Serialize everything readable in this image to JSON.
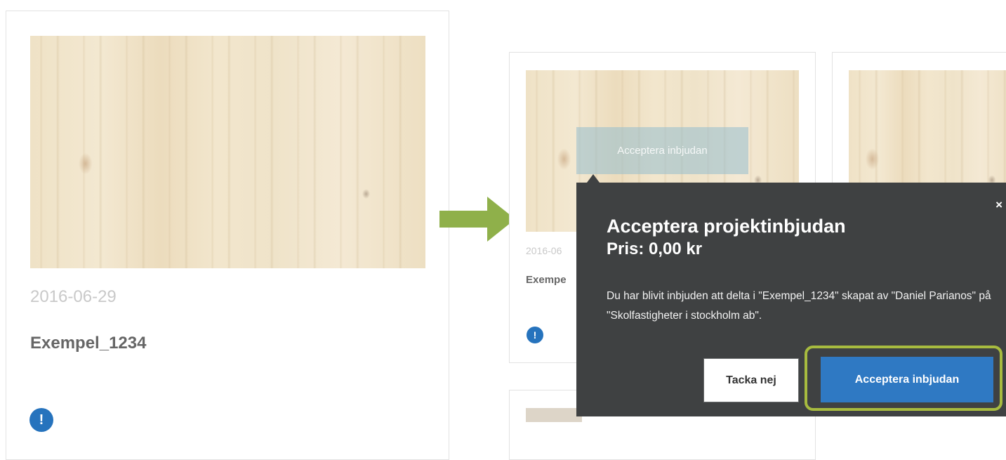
{
  "left_card": {
    "date": "2016-06-29",
    "title": "Exempel_1234",
    "info_icon": "!"
  },
  "right_card": {
    "date_partial": "2016-06",
    "title_partial": "Exempe",
    "info_icon": "!"
  },
  "tooltip_button": {
    "label": "Acceptera inbjudan"
  },
  "popover": {
    "close": "×",
    "title": "Acceptera projektinbjudan",
    "price": "Pris: 0,00 kr",
    "message": "Du har blivit inbjuden att delta i \"Exempel_1234\" skapat av \"Daniel Parianos\" på \"Skolfastigheter i stockholm ab\".",
    "decline_label": "Tacka nej",
    "accept_label": "Acceptera inbjudan"
  },
  "colors": {
    "arrow": "#8fb04a",
    "highlight": "#a7bb3f",
    "accept": "#2f79c3",
    "popover_bg": "#3f4142",
    "badge": "#2673bd"
  }
}
